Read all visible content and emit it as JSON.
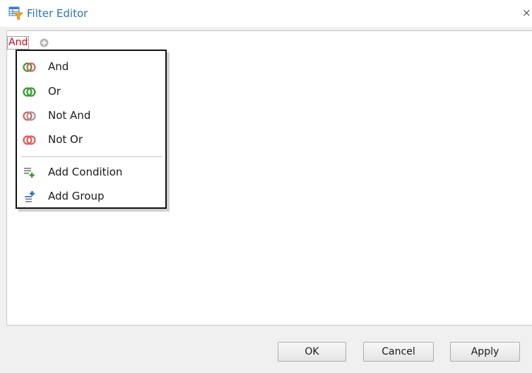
{
  "window": {
    "title": "Filter Editor",
    "close_glyph": "×",
    "title_icon": "filter-editor-icon"
  },
  "editor": {
    "group_operator": "And",
    "add_icon": "plus-circle-icon"
  },
  "menu": {
    "items": [
      {
        "label": "And",
        "icon": "and-icon",
        "colors": [
          "#2f9b2f",
          "#e05a5a"
        ]
      },
      {
        "label": "Or",
        "icon": "or-icon",
        "colors": [
          "#2f9b2f",
          "#2f9b2f"
        ]
      },
      {
        "label": "Not And",
        "icon": "not-and-icon",
        "colors": [
          "#e05a5a",
          "#999999"
        ]
      },
      {
        "label": "Not Or",
        "icon": "not-or-icon",
        "colors": [
          "#e05a5a",
          "#e05a5a"
        ]
      },
      {
        "label": "Add Condition",
        "icon": "add-condition-icon"
      },
      {
        "label": "Add Group",
        "icon": "add-group-icon"
      }
    ]
  },
  "buttons": {
    "ok": "OK",
    "cancel": "Cancel",
    "apply": "Apply"
  },
  "colors": {
    "title": "#2b73b7",
    "operator": "#d0021b"
  }
}
